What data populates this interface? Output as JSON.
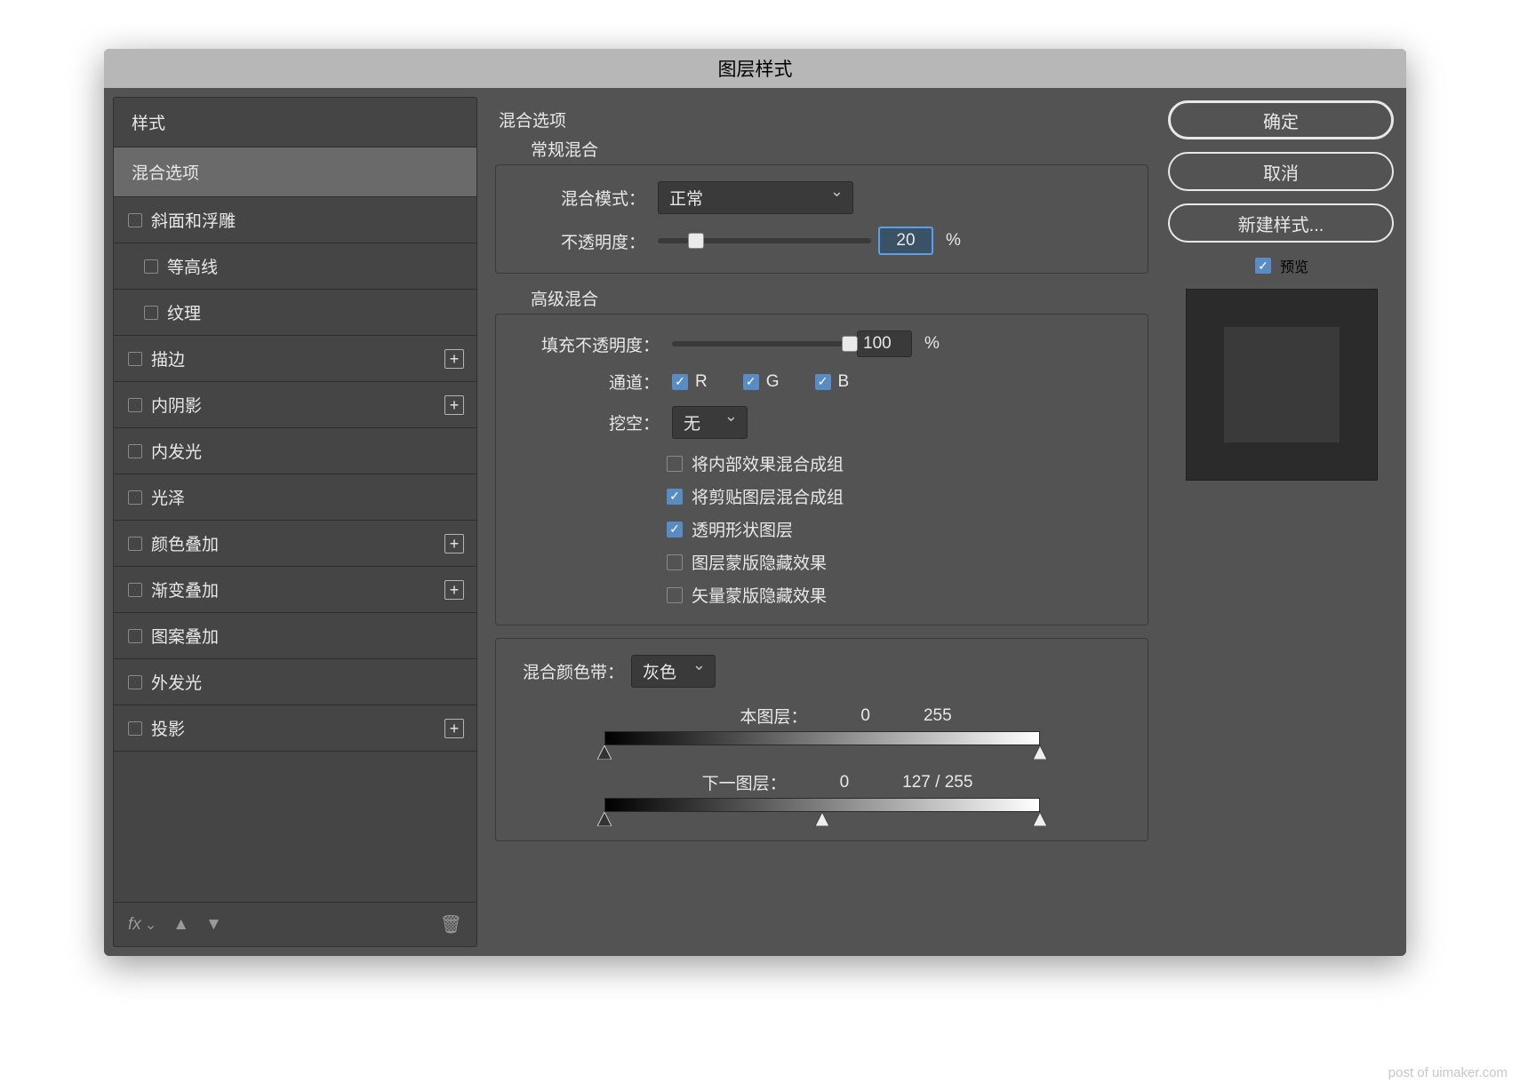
{
  "dialog_title": "图层样式",
  "sidebar": {
    "styles_header": "样式",
    "blending_options": "混合选项",
    "bevel_emboss": "斜面和浮雕",
    "contour": "等高线",
    "texture": "纹理",
    "stroke": "描边",
    "inner_shadow": "内阴影",
    "inner_glow": "内发光",
    "satin": "光泽",
    "color_overlay": "颜色叠加",
    "gradient_overlay": "渐变叠加",
    "pattern_overlay": "图案叠加",
    "outer_glow": "外发光",
    "drop_shadow": "投影",
    "fx_label": "fx"
  },
  "main": {
    "section_blending_options": "混合选项",
    "general_blending": "常规混合",
    "blend_mode_label": "混合模式：",
    "blend_mode_value": "正常",
    "opacity_label": "不透明度：",
    "opacity_value": "20",
    "pct": "%",
    "advanced_blending": "高级混合",
    "fill_opacity_label": "填充不透明度：",
    "fill_opacity_value": "100",
    "channels_label": "通道：",
    "ch_r": "R",
    "ch_g": "G",
    "ch_b": "B",
    "knockout_label": "挖空：",
    "knockout_value": "无",
    "opt_inner_group": "将内部效果混合成组",
    "opt_clip_group": "将剪贴图层混合成组",
    "opt_trans_shape": "透明形状图层",
    "opt_mask_hide": "图层蒙版隐藏效果",
    "opt_vmask_hide": "矢量蒙版隐藏效果",
    "blend_if_label": "混合颜色带：",
    "blend_if_value": "灰色",
    "this_layer": "本图层：",
    "this_layer_lo": "0",
    "this_layer_hi": "255",
    "under_layer": "下一图层：",
    "under_layer_lo": "0",
    "under_layer_split": "127  /  255"
  },
  "right": {
    "ok": "确定",
    "cancel": "取消",
    "new_style": "新建样式...",
    "preview": "预览"
  },
  "watermark": "post of uimaker.com"
}
